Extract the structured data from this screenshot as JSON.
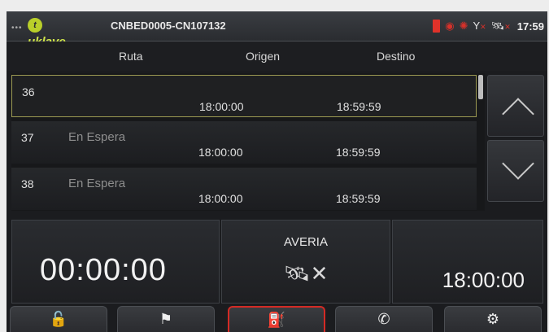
{
  "status_bar": {
    "logo_text": "tuklave",
    "device_id": "CNBED0005-CN107132",
    "clock": "17:59",
    "icons": [
      "flag-icon",
      "alarm-icon",
      "alert-icon",
      "antenna-icon",
      "gps-icon"
    ],
    "colors": {
      "alert": "#d6312a",
      "logo": "#cde24a"
    }
  },
  "table": {
    "headers": {
      "route": "Ruta",
      "origin": "Origen",
      "destination": "Destino"
    },
    "rows": [
      {
        "route": "36",
        "state": "",
        "origin": "18:00:00",
        "destination": "18:59:59"
      },
      {
        "route": "37",
        "state": "En Espera",
        "origin": "18:00:00",
        "destination": "18:59:59"
      },
      {
        "route": "38",
        "state": "En Espera",
        "origin": "18:00:00",
        "destination": "18:59:59"
      }
    ],
    "selected_row": 0
  },
  "panels": {
    "elapsed_timer": "00:00:00",
    "averia_label": "AVERIA",
    "gps_status_icon": "gps-off-icon",
    "scheduled_time": "18:00:00"
  },
  "toolbar": {
    "buttons": [
      {
        "icon": "unlock-icon",
        "glyph": "🔓"
      },
      {
        "icon": "stop-sign-icon",
        "glyph": "⚑"
      },
      {
        "icon": "fuel-pump-icon",
        "glyph": "⛽"
      },
      {
        "icon": "phone-icon",
        "glyph": "✆"
      },
      {
        "icon": "settings-icon",
        "glyph": "⚙"
      }
    ],
    "active_index": 2,
    "active_color": "#d42a25"
  }
}
